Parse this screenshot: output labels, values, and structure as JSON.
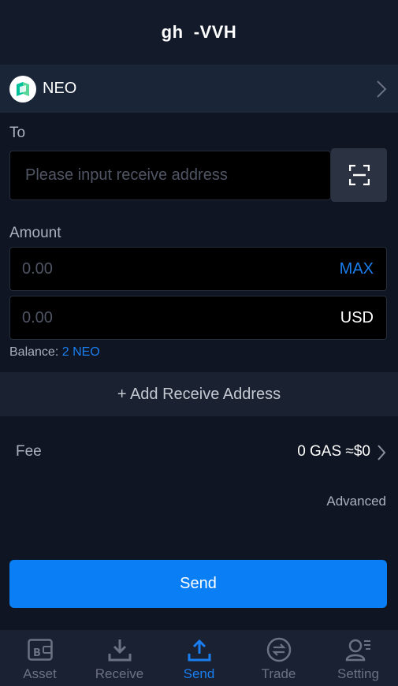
{
  "header": {
    "title": "gh  -VVH"
  },
  "asset": {
    "name": "NEO",
    "icon": "neo-logo-icon"
  },
  "to": {
    "label": "To",
    "placeholder": "Please input receive address",
    "value": ""
  },
  "amount": {
    "label": "Amount",
    "coin_placeholder": "0.00",
    "max_label": "MAX",
    "fiat_placeholder": "0.00",
    "fiat_unit": "USD"
  },
  "balance": {
    "label": "Balance:",
    "value": "2 NEO"
  },
  "add_address": {
    "label": "+ Add Receive Address"
  },
  "fee": {
    "label": "Fee",
    "value": "0 GAS ≈$0"
  },
  "advanced": {
    "label": "Advanced"
  },
  "send_button": {
    "label": "Send"
  },
  "tabs": [
    {
      "label": "Asset",
      "icon": "wallet-icon",
      "active": false
    },
    {
      "label": "Receive",
      "icon": "download-icon",
      "active": false
    },
    {
      "label": "Send",
      "icon": "upload-icon",
      "active": true
    },
    {
      "label": "Trade",
      "icon": "exchange-icon",
      "active": false
    },
    {
      "label": "Setting",
      "icon": "user-settings-icon",
      "active": false
    }
  ],
  "colors": {
    "background": "#0f1523",
    "accent": "#0a7ff5",
    "link": "#1a7ef0",
    "inactive_tab": "#6b7282"
  }
}
